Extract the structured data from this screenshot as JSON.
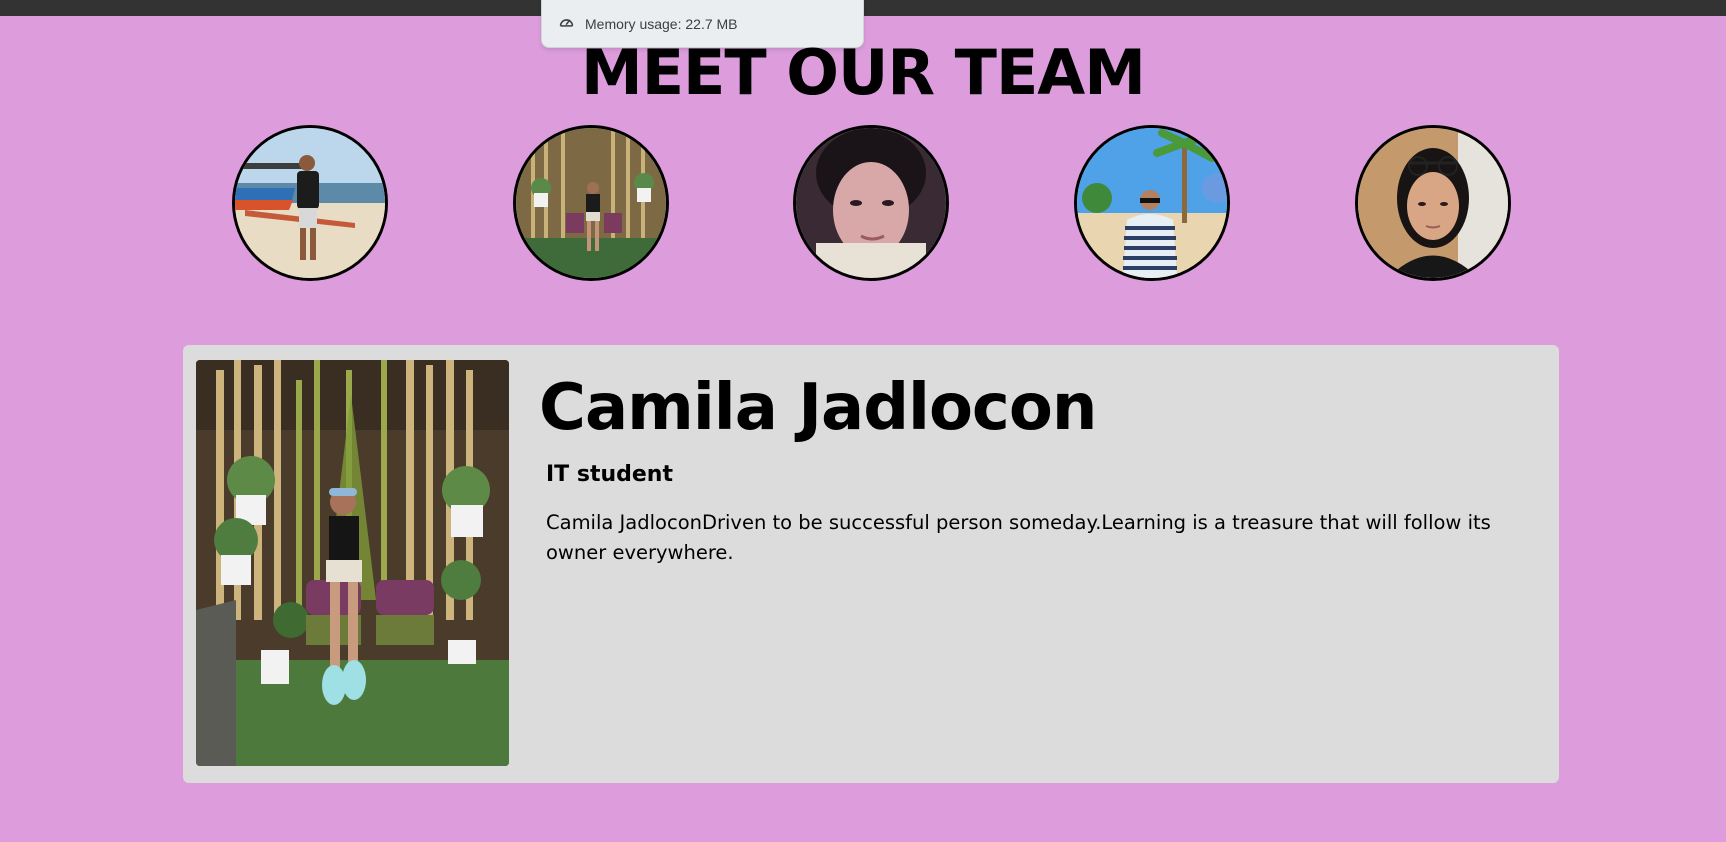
{
  "browser": {
    "memory_usage_text": "Memory usage: 22.7 MB",
    "topbar_color": "#333333"
  },
  "page": {
    "background_color": "#dd9ddd",
    "title": "MEET OUR TEAM"
  },
  "team": {
    "avatars": [
      {
        "icon": "photo-man-beach-boats"
      },
      {
        "icon": "photo-woman-bamboo-garden"
      },
      {
        "icon": "photo-woman-selfie"
      },
      {
        "icon": "photo-man-palm-beach"
      },
      {
        "icon": "photo-woman-glasses"
      }
    ]
  },
  "profile": {
    "name": "Camila Jadlocon",
    "role": "IT student",
    "bio": "Camila JadloconDriven to be successful person someday.Learning is a treasure that will follow its owner everywhere.",
    "card_color": "#dcdcdc"
  }
}
